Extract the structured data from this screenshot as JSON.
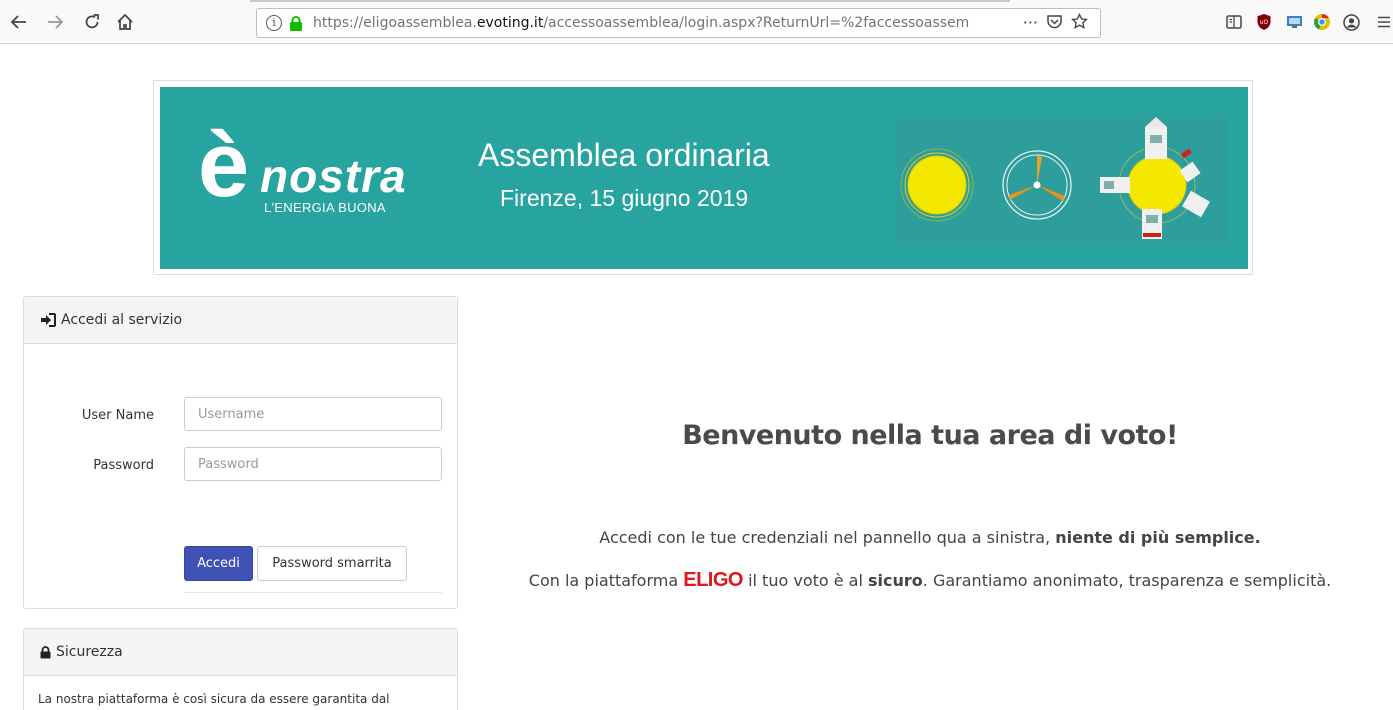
{
  "browser": {
    "url_prefix": "https://eligoassemblea.",
    "url_domain": "evoting.it",
    "url_path": "/accessoassemblea/login.aspx?ReturnUrl=%2faccessoassem",
    "more_actions": "···"
  },
  "banner": {
    "logo_letter": "è",
    "logo_word": "nostra",
    "logo_tagline": "L'ENERGIA BUONA",
    "title": "Assemblea ordinaria",
    "subtitle": "Firenze, 15 giugno 2019",
    "accent_color": "#27a3a0"
  },
  "login_panel": {
    "heading": "Accedi al servizio",
    "username_label": "User Name",
    "username_placeholder": "Username",
    "password_label": "Password",
    "password_placeholder": "Password",
    "submit_label": "Accedi",
    "forgot_label": "Password smarrita",
    "primary_color": "#3f51b5"
  },
  "security_panel": {
    "heading": "Sicurezza",
    "text": "La nostra piattaforma è così sicura da essere garantita dal"
  },
  "welcome": {
    "title": "Benvenuto nella tua area di voto!",
    "line1_pre": "Accedi con le tue credenziali nel pannello qua a sinistra,",
    "line1_bold": "niente di più semplice.",
    "line2_pre": "Con la piattaforma",
    "brand": "ELIGO",
    "line2_mid": "il tuo voto è al",
    "line2_bold": "sicuro",
    "line2_post": ". Garantiamo anonimato, trasparenza e semplicità."
  }
}
